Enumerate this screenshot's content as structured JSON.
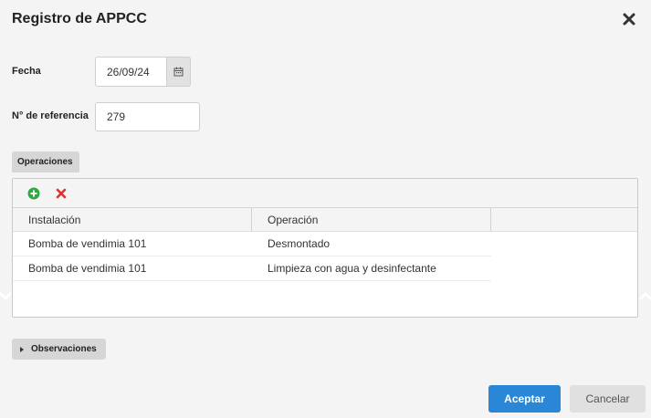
{
  "dialog": {
    "title": "Registro de APPCC"
  },
  "form": {
    "fecha_label": "Fecha",
    "fecha_value": "26/09/24",
    "referencia_label": "N° de referencia",
    "referencia_value": "279"
  },
  "operaciones": {
    "tab_label": "Operaciones",
    "columns": [
      "Instalación",
      "Operación",
      ""
    ],
    "rows": [
      {
        "instalacion": "Bomba de vendimia 101",
        "operacion": "Desmontado"
      },
      {
        "instalacion": "Bomba de vendimia 101",
        "operacion": "Limpieza con agua y desinfectante"
      }
    ]
  },
  "observaciones": {
    "label": "Observaciones"
  },
  "footer": {
    "accept_label": "Aceptar",
    "cancel_label": "Cancelar"
  },
  "icons": {
    "close": "close-icon",
    "calendar": "calendar-icon",
    "add": "add-circle-icon",
    "delete": "delete-x-icon",
    "expand": "caret-right-icon"
  },
  "colors": {
    "accent": "#2a86d6",
    "add_green": "#2eaa43",
    "delete_red": "#e03030"
  }
}
